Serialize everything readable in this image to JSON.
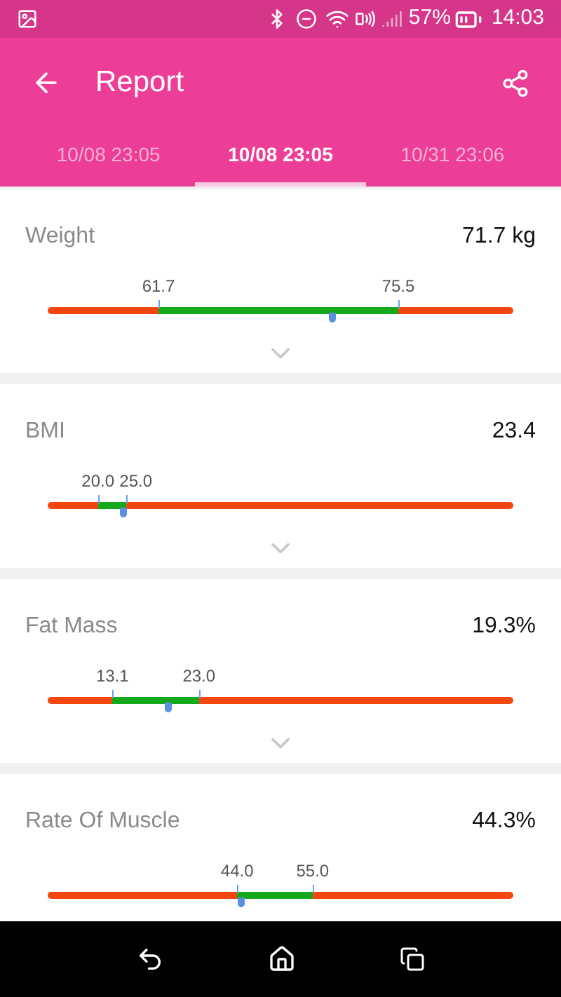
{
  "status_bar": {
    "battery": "57%",
    "time": "14:03"
  },
  "app_bar": {
    "title": "Report"
  },
  "tabs": [
    {
      "label": "10/08 23:05",
      "selected": false
    },
    {
      "label": "10/08 23:05",
      "selected": true
    },
    {
      "label": "10/31 23:06",
      "selected": false
    }
  ],
  "metrics": [
    {
      "name": "Weight",
      "value": "71.7 kg",
      "level": 0.611,
      "range": {
        "low": {
          "label": "61.7",
          "level": 0.238
        },
        "high": {
          "label": "75.5",
          "level": 0.753
        }
      }
    },
    {
      "name": "BMI",
      "value": "23.4",
      "level": 0.163,
      "range": {
        "low": {
          "label": "20.0",
          "level": 0.108
        },
        "high": {
          "label": "25.0",
          "level": 0.169
        }
      }
    },
    {
      "name": "Fat Mass",
      "value": "19.3%",
      "level": 0.259,
      "range": {
        "low": {
          "label": "13.1",
          "level": 0.139
        },
        "high": {
          "label": "23.0",
          "level": 0.325
        }
      }
    },
    {
      "name": "Rate Of Muscle",
      "value": "44.3%",
      "level": 0.416,
      "range": {
        "low": {
          "label": "44.0",
          "level": 0.407
        },
        "high": {
          "label": "55.0",
          "level": 0.569
        }
      }
    }
  ]
}
